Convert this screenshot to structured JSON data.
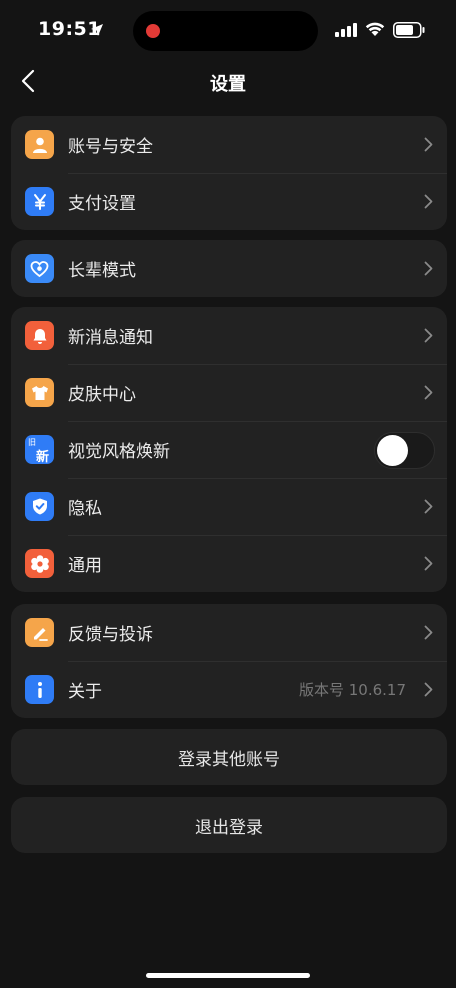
{
  "status_bar": {
    "time": "19:51"
  },
  "header": {
    "title": "设置"
  },
  "groups": [
    {
      "items": [
        {
          "label": "账号与安全",
          "icon": "person-icon",
          "color": "#f5a54a"
        },
        {
          "label": "支付设置",
          "icon": "yen-icon",
          "color": "#2f7cf6"
        }
      ]
    },
    {
      "items": [
        {
          "label": "长辈模式",
          "icon": "heart-icon",
          "color": "#3a8af7"
        }
      ]
    },
    {
      "items": [
        {
          "label": "新消息通知",
          "icon": "bell-icon",
          "color": "#f2603b"
        },
        {
          "label": "皮肤中心",
          "icon": "shirt-icon",
          "color": "#f5a54a"
        },
        {
          "label": "视觉风格焕新",
          "icon": "renew-icon",
          "color": "#2f7cf6",
          "badge_old": "旧",
          "badge_new": "新",
          "toggle_on": false
        },
        {
          "label": "隐私",
          "icon": "shield-icon",
          "color": "#2f7cf6"
        },
        {
          "label": "通用",
          "icon": "gear-icon",
          "color": "#f2603b"
        }
      ]
    },
    {
      "items": [
        {
          "label": "反馈与投诉",
          "icon": "pen-icon",
          "color": "#f5a54a"
        },
        {
          "label": "关于",
          "icon": "info-icon",
          "color": "#2f7cf6",
          "value": "版本号 10.6.17"
        }
      ]
    }
  ],
  "actions": {
    "switch_account": "登录其他账号",
    "logout": "退出登录"
  }
}
